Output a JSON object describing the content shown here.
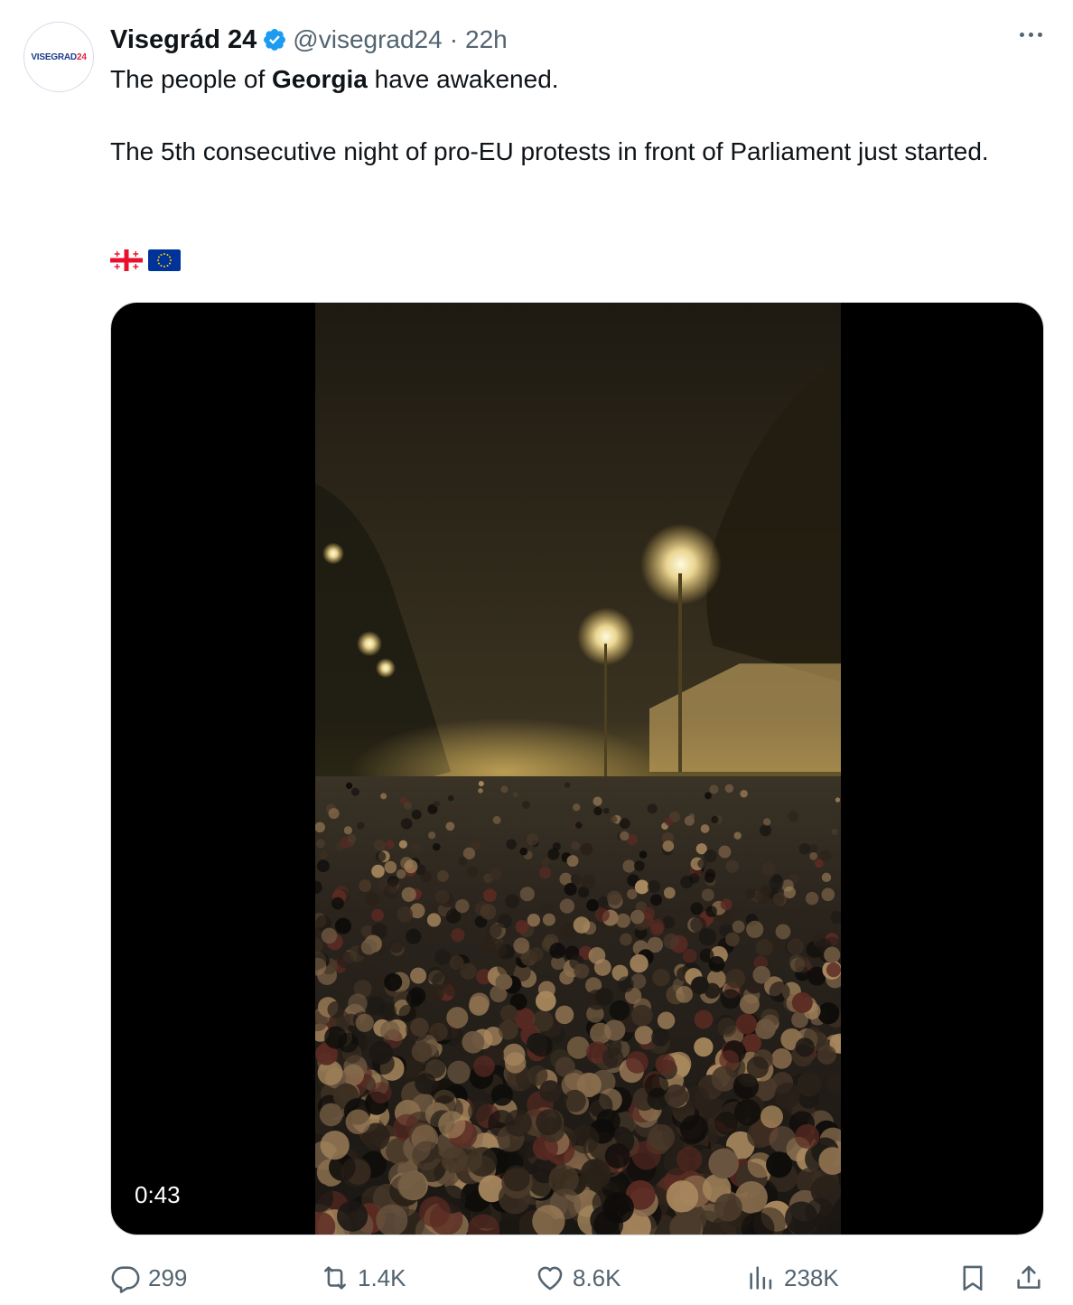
{
  "tweet": {
    "avatar": {
      "text_main": "VISEGRAD",
      "text_num": "24"
    },
    "author_name": "Visegrád 24",
    "handle": "@visegrad24",
    "separator": "·",
    "time": "22h",
    "line1_pre": "The people of ",
    "line1_bold": "Georgia",
    "line1_post": " have awakened.",
    "line2": "The 5th consecutive night of pro-EU protests in front of Parliament just started.",
    "flags": [
      "georgia-flag-icon",
      "eu-flag-icon"
    ]
  },
  "media": {
    "duration": "0:43"
  },
  "actions": {
    "replies": "299",
    "reposts": "1.4K",
    "likes": "8.6K",
    "views": "238K"
  },
  "colors": {
    "verified": "#1d9bf0",
    "secondary_text": "#536471",
    "georgia_red": "#e8112d",
    "eu_blue": "#003399",
    "eu_gold": "#ffcc00"
  }
}
